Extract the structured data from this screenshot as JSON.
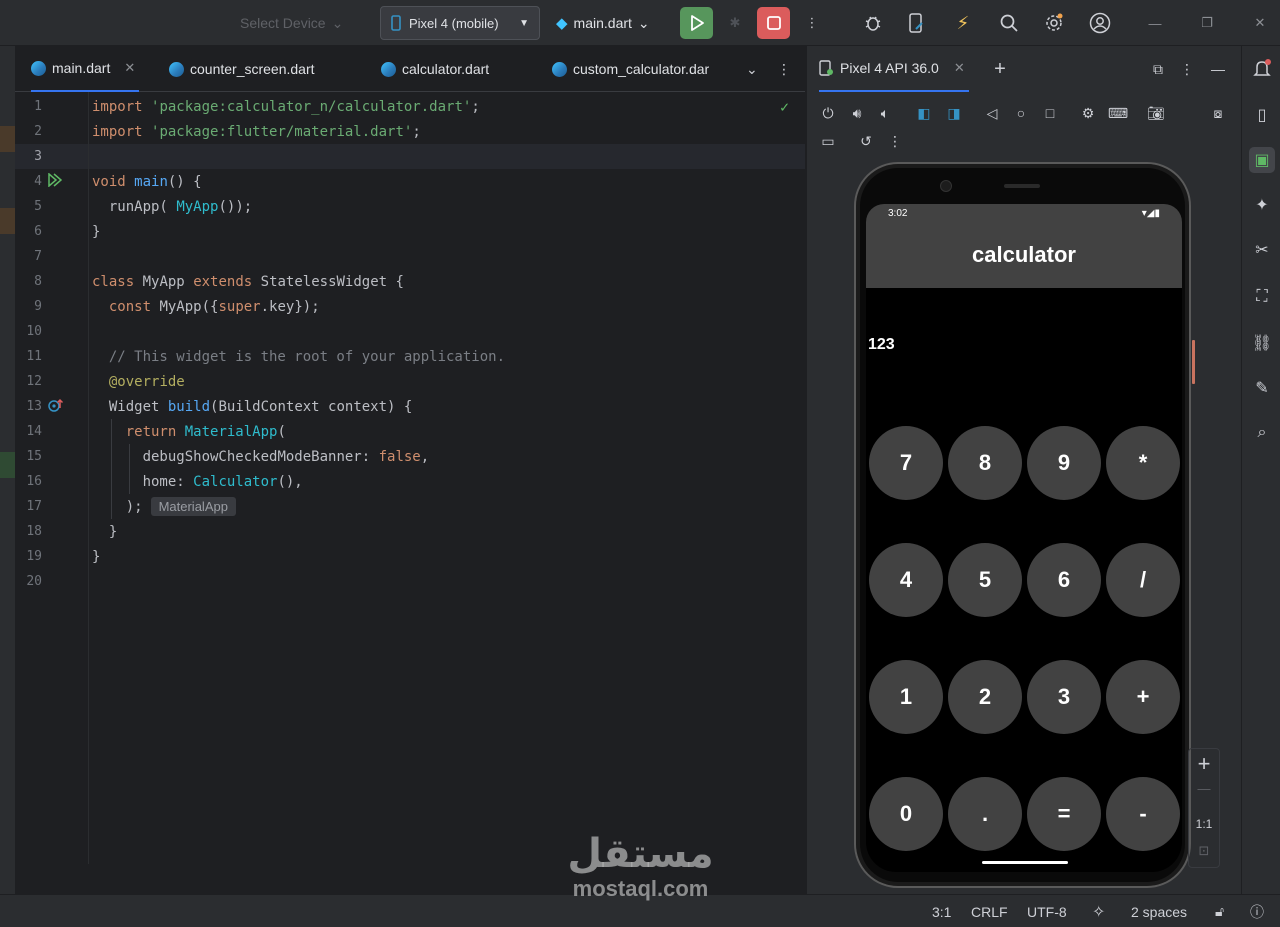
{
  "toolbar": {
    "device_placeholder": "Select Device",
    "device": "Pixel 4 (mobile)",
    "run_config": "main.dart",
    "menu_icon": "kebab-icon",
    "right_icons": [
      "bug-icon",
      "device-manager-icon",
      "flash-icon",
      "search-icon",
      "settings-icon",
      "account-icon"
    ]
  },
  "tabs": [
    {
      "label": "main.dart",
      "active": true
    },
    {
      "label": "counter_screen.dart"
    },
    {
      "label": "calculator.dart"
    },
    {
      "label": "custom_calculator.dar"
    }
  ],
  "code": {
    "lines": [
      {
        "n": "1"
      },
      {
        "n": "2"
      },
      {
        "n": "3"
      },
      {
        "n": "4"
      },
      {
        "n": "5"
      },
      {
        "n": "6"
      },
      {
        "n": "7"
      },
      {
        "n": "8"
      },
      {
        "n": "9"
      },
      {
        "n": "10"
      },
      {
        "n": "11"
      },
      {
        "n": "12"
      },
      {
        "n": "13"
      },
      {
        "n": "14"
      },
      {
        "n": "15"
      },
      {
        "n": "16"
      },
      {
        "n": "17"
      },
      {
        "n": "18"
      },
      {
        "n": "19"
      },
      {
        "n": "20"
      }
    ],
    "tokens": {
      "import": "import",
      "pkg_calc": "'package:calculator_n/calculator.dart'",
      "pkg_mat": "'package:flutter/material.dart'",
      "semi": ";",
      "void": "void",
      "main": "main",
      "main_open": "() {",
      "run_app": "runApp(",
      "my_app": "MyApp",
      "run_close": "());",
      "close_brace": "}",
      "class": "class",
      "extends": "extends",
      "stateless": "StatelessWidget {",
      "const": "const",
      "ctor_open": "MyApp({",
      "super": "super",
      "ctor_rest": ".key});",
      "comment": "// This widget is the root of your application.",
      "at": "@",
      "override": "override",
      "widget": "Widget",
      "build": "build",
      "build_args": "(BuildContext context) {",
      "return": "return",
      "material_app": "MaterialApp",
      "paren_open": "(",
      "debug_banner": "debugShowCheckedModeBanner: ",
      "false": "false",
      "comma": ",",
      "home": "home: ",
      "calculator": "Calculator",
      "calc_close": "(),",
      "close_paren": ");",
      "hint": "MaterialApp"
    }
  },
  "status": {
    "position": "3:1",
    "line_sep": "CRLF",
    "encoding": "UTF-8",
    "indent": "2 spaces"
  },
  "emulator": {
    "tab": "Pixel 4 API 36.0",
    "phone": {
      "time": "3:02",
      "title": "calculator",
      "display": "123",
      "keys": [
        "7",
        "8",
        "9",
        "*",
        "4",
        "5",
        "6",
        "/",
        "1",
        "2",
        "3",
        "+",
        "0",
        ".",
        "=",
        "-"
      ]
    },
    "zoom": {
      "ratio": "1:1"
    }
  },
  "watermark": {
    "arabic": "مستقل",
    "latin": "mostaql.com"
  }
}
